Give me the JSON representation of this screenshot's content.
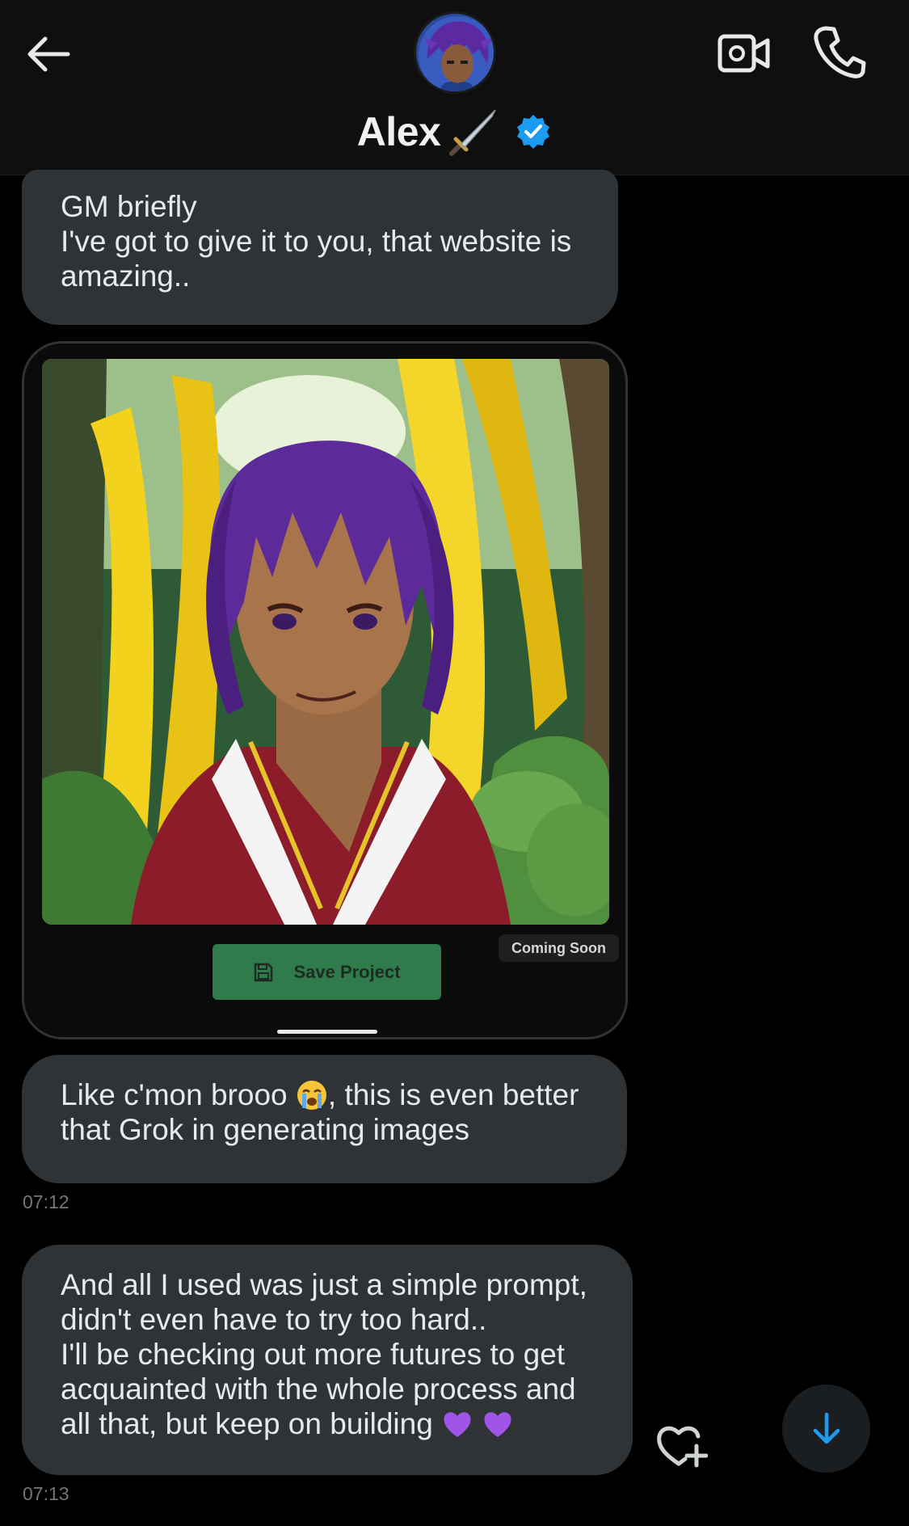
{
  "header": {
    "contact_name": "Alex",
    "verified": true,
    "icons": [
      "arrow-left-icon",
      "dagger-icon",
      "verified-badge-icon",
      "video-camera-icon",
      "phone-icon"
    ]
  },
  "messages": [
    {
      "text": "GM briefly\nI've got to give it to you, that website is amazing.."
    },
    {
      "attachment": {
        "type": "image",
        "coming_soon_label": "Coming Soon",
        "button_label": "Save Project"
      }
    },
    {
      "text_before_emoji": "Like c'mon brooo ",
      "emoji": "loudly-crying-face",
      "text_after_emoji": ", this is even better that Grok in generating images",
      "timestamp": "07:12"
    },
    {
      "text": "And all I used was just a simple prompt, didn't even have to try too hard..\nI'll be checking out more futures to get acquainted with the whole process and all that, but keep on building ",
      "emoji": [
        "purple-heart",
        "purple-heart"
      ],
      "timestamp": "07:13"
    }
  ],
  "colors": {
    "background": "#000000",
    "bubble": "#2f3336",
    "accent": "#1d9bf0",
    "save_button": "#2f7b4c"
  }
}
